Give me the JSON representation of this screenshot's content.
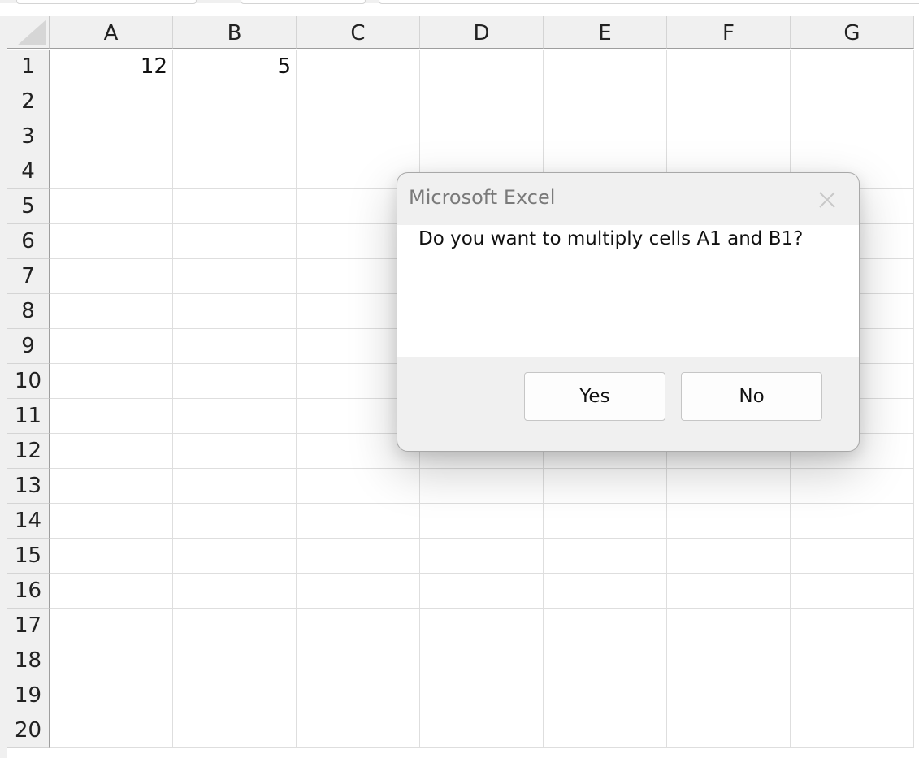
{
  "grid": {
    "columns": [
      "A",
      "B",
      "C",
      "D",
      "E",
      "F",
      "G"
    ],
    "rows": [
      "1",
      "2",
      "3",
      "4",
      "5",
      "6",
      "7",
      "8",
      "9",
      "10",
      "11",
      "12",
      "13",
      "14",
      "15",
      "16",
      "17",
      "18",
      "19",
      "20"
    ],
    "cells": {
      "A1": "12",
      "B1": "5"
    }
  },
  "dialog": {
    "title": "Microsoft Excel",
    "message": "Do you want to multiply cells A1 and B1?",
    "yes_label": "Yes",
    "no_label": "No",
    "close_icon": "close-icon"
  }
}
